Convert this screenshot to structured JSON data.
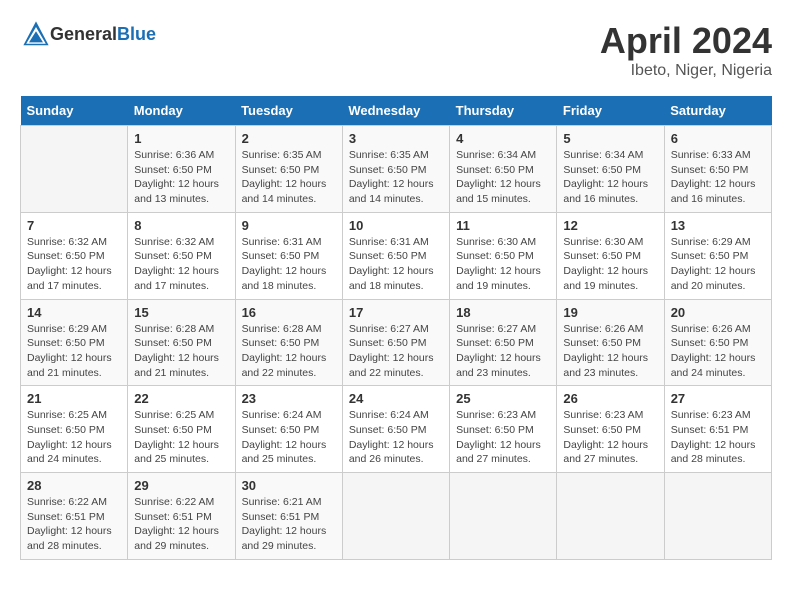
{
  "header": {
    "logo_general": "General",
    "logo_blue": "Blue",
    "month": "April 2024",
    "location": "Ibeto, Niger, Nigeria"
  },
  "columns": [
    "Sunday",
    "Monday",
    "Tuesday",
    "Wednesday",
    "Thursday",
    "Friday",
    "Saturday"
  ],
  "weeks": [
    [
      {
        "day": "",
        "sunrise": "",
        "sunset": "",
        "daylight": ""
      },
      {
        "day": "1",
        "sunrise": "Sunrise: 6:36 AM",
        "sunset": "Sunset: 6:50 PM",
        "daylight": "Daylight: 12 hours and 13 minutes."
      },
      {
        "day": "2",
        "sunrise": "Sunrise: 6:35 AM",
        "sunset": "Sunset: 6:50 PM",
        "daylight": "Daylight: 12 hours and 14 minutes."
      },
      {
        "day": "3",
        "sunrise": "Sunrise: 6:35 AM",
        "sunset": "Sunset: 6:50 PM",
        "daylight": "Daylight: 12 hours and 14 minutes."
      },
      {
        "day": "4",
        "sunrise": "Sunrise: 6:34 AM",
        "sunset": "Sunset: 6:50 PM",
        "daylight": "Daylight: 12 hours and 15 minutes."
      },
      {
        "day": "5",
        "sunrise": "Sunrise: 6:34 AM",
        "sunset": "Sunset: 6:50 PM",
        "daylight": "Daylight: 12 hours and 16 minutes."
      },
      {
        "day": "6",
        "sunrise": "Sunrise: 6:33 AM",
        "sunset": "Sunset: 6:50 PM",
        "daylight": "Daylight: 12 hours and 16 minutes."
      }
    ],
    [
      {
        "day": "7",
        "sunrise": "Sunrise: 6:32 AM",
        "sunset": "Sunset: 6:50 PM",
        "daylight": "Daylight: 12 hours and 17 minutes."
      },
      {
        "day": "8",
        "sunrise": "Sunrise: 6:32 AM",
        "sunset": "Sunset: 6:50 PM",
        "daylight": "Daylight: 12 hours and 17 minutes."
      },
      {
        "day": "9",
        "sunrise": "Sunrise: 6:31 AM",
        "sunset": "Sunset: 6:50 PM",
        "daylight": "Daylight: 12 hours and 18 minutes."
      },
      {
        "day": "10",
        "sunrise": "Sunrise: 6:31 AM",
        "sunset": "Sunset: 6:50 PM",
        "daylight": "Daylight: 12 hours and 18 minutes."
      },
      {
        "day": "11",
        "sunrise": "Sunrise: 6:30 AM",
        "sunset": "Sunset: 6:50 PM",
        "daylight": "Daylight: 12 hours and 19 minutes."
      },
      {
        "day": "12",
        "sunrise": "Sunrise: 6:30 AM",
        "sunset": "Sunset: 6:50 PM",
        "daylight": "Daylight: 12 hours and 19 minutes."
      },
      {
        "day": "13",
        "sunrise": "Sunrise: 6:29 AM",
        "sunset": "Sunset: 6:50 PM",
        "daylight": "Daylight: 12 hours and 20 minutes."
      }
    ],
    [
      {
        "day": "14",
        "sunrise": "Sunrise: 6:29 AM",
        "sunset": "Sunset: 6:50 PM",
        "daylight": "Daylight: 12 hours and 21 minutes."
      },
      {
        "day": "15",
        "sunrise": "Sunrise: 6:28 AM",
        "sunset": "Sunset: 6:50 PM",
        "daylight": "Daylight: 12 hours and 21 minutes."
      },
      {
        "day": "16",
        "sunrise": "Sunrise: 6:28 AM",
        "sunset": "Sunset: 6:50 PM",
        "daylight": "Daylight: 12 hours and 22 minutes."
      },
      {
        "day": "17",
        "sunrise": "Sunrise: 6:27 AM",
        "sunset": "Sunset: 6:50 PM",
        "daylight": "Daylight: 12 hours and 22 minutes."
      },
      {
        "day": "18",
        "sunrise": "Sunrise: 6:27 AM",
        "sunset": "Sunset: 6:50 PM",
        "daylight": "Daylight: 12 hours and 23 minutes."
      },
      {
        "day": "19",
        "sunrise": "Sunrise: 6:26 AM",
        "sunset": "Sunset: 6:50 PM",
        "daylight": "Daylight: 12 hours and 23 minutes."
      },
      {
        "day": "20",
        "sunrise": "Sunrise: 6:26 AM",
        "sunset": "Sunset: 6:50 PM",
        "daylight": "Daylight: 12 hours and 24 minutes."
      }
    ],
    [
      {
        "day": "21",
        "sunrise": "Sunrise: 6:25 AM",
        "sunset": "Sunset: 6:50 PM",
        "daylight": "Daylight: 12 hours and 24 minutes."
      },
      {
        "day": "22",
        "sunrise": "Sunrise: 6:25 AM",
        "sunset": "Sunset: 6:50 PM",
        "daylight": "Daylight: 12 hours and 25 minutes."
      },
      {
        "day": "23",
        "sunrise": "Sunrise: 6:24 AM",
        "sunset": "Sunset: 6:50 PM",
        "daylight": "Daylight: 12 hours and 25 minutes."
      },
      {
        "day": "24",
        "sunrise": "Sunrise: 6:24 AM",
        "sunset": "Sunset: 6:50 PM",
        "daylight": "Daylight: 12 hours and 26 minutes."
      },
      {
        "day": "25",
        "sunrise": "Sunrise: 6:23 AM",
        "sunset": "Sunset: 6:50 PM",
        "daylight": "Daylight: 12 hours and 27 minutes."
      },
      {
        "day": "26",
        "sunrise": "Sunrise: 6:23 AM",
        "sunset": "Sunset: 6:50 PM",
        "daylight": "Daylight: 12 hours and 27 minutes."
      },
      {
        "day": "27",
        "sunrise": "Sunrise: 6:23 AM",
        "sunset": "Sunset: 6:51 PM",
        "daylight": "Daylight: 12 hours and 28 minutes."
      }
    ],
    [
      {
        "day": "28",
        "sunrise": "Sunrise: 6:22 AM",
        "sunset": "Sunset: 6:51 PM",
        "daylight": "Daylight: 12 hours and 28 minutes."
      },
      {
        "day": "29",
        "sunrise": "Sunrise: 6:22 AM",
        "sunset": "Sunset: 6:51 PM",
        "daylight": "Daylight: 12 hours and 29 minutes."
      },
      {
        "day": "30",
        "sunrise": "Sunrise: 6:21 AM",
        "sunset": "Sunset: 6:51 PM",
        "daylight": "Daylight: 12 hours and 29 minutes."
      },
      {
        "day": "",
        "sunrise": "",
        "sunset": "",
        "daylight": ""
      },
      {
        "day": "",
        "sunrise": "",
        "sunset": "",
        "daylight": ""
      },
      {
        "day": "",
        "sunrise": "",
        "sunset": "",
        "daylight": ""
      },
      {
        "day": "",
        "sunrise": "",
        "sunset": "",
        "daylight": ""
      }
    ]
  ]
}
